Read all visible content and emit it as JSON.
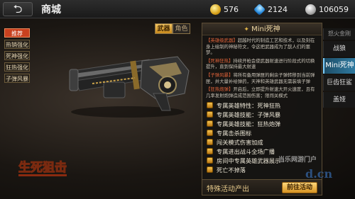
{
  "header": {
    "back_glyph": "⮌",
    "title": "商城",
    "currencies": [
      {
        "icon": "gold-coin-icon",
        "value": "576"
      },
      {
        "icon": "diamond-icon",
        "value": "2124"
      },
      {
        "icon": "silver-coin-icon",
        "value": "106059"
      }
    ]
  },
  "categories": [
    "推荐",
    "热销强化",
    "死神强化",
    "狂热强化",
    "子弹风暴"
  ],
  "toggle": {
    "weapon": "武器",
    "role": "角色"
  },
  "panel": {
    "title": "Mini死神",
    "title_glyph": "✦",
    "desc": [
      {
        "tag": "【英雄级武器】",
        "text": "超越时代的制造工艺和技术，以及刻在身上绘制的神秘符文，令这把武器成为了敌人们的噩梦。"
      },
      {
        "tag": "【死神狂热】",
        "text": "持续开枪会使武器射速进行阶段式的切换提升，直到保持最大射速"
      },
      {
        "tag": "【子弹风暴】",
        "text": "将所有备用弹匣的剩余子弹转移到当前弹匣，并大量补给弹药，天神和英雄武器无需装填子弹"
      },
      {
        "tag": "【狂热炮弹】",
        "text": "开启后，立即提升射速大开火速度，且有几率发射炮弹造成范围伤害；限闯关模式"
      }
    ],
    "features": [
      "专属英雄特性：死神狂热",
      "专属英雄技能：子弹风暴",
      "专属英雄技能：狂热炮弹",
      "专属击杀图标",
      "闯关模式伤害加成",
      "专属进出战斗全场广播",
      "房间中专属英雄武器展示",
      "死亡不掉落"
    ],
    "source": "特殊活动产出",
    "go_button": "前往活动"
  },
  "right_list": {
    "top": "怒火金刚",
    "items": [
      "战狼",
      "Mini死神",
      "巨齿狂鲨",
      "盖娅"
    ],
    "active": "Mini死神"
  },
  "logo_text": "生死狙击",
  "watermark": {
    "line1": "当乐网游门户",
    "line2": "d.cn"
  }
}
